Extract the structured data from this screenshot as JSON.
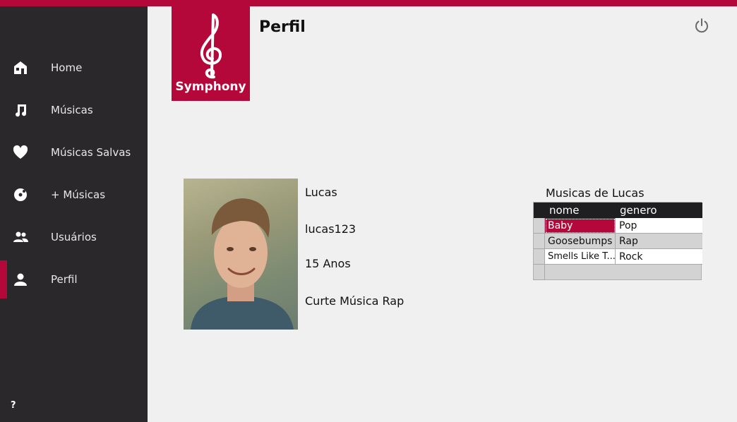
{
  "app": {
    "accent": "#b5083a",
    "sidebar_bg": "#2a282a",
    "logo_text": "Symphony"
  },
  "header": {
    "title": "Perfil",
    "power_icon": "power-icon"
  },
  "sidebar": {
    "items": [
      {
        "label": "Home",
        "icon": "home-icon"
      },
      {
        "label": "Músicas",
        "icon": "music-note-icon"
      },
      {
        "label": "Músicas Salvas",
        "icon": "heart-icon"
      },
      {
        "label": "+ Músicas",
        "icon": "disc-icon"
      },
      {
        "label": "Usuários",
        "icon": "users-icon"
      },
      {
        "label": "Perfil",
        "icon": "person-icon"
      }
    ],
    "active": "Perfil",
    "help": "?"
  },
  "profile": {
    "name": "Lucas",
    "username": "lucas123",
    "age": "15 Anos",
    "bio": "Curte Música Rap"
  },
  "songs_table": {
    "title": "Musicas de Lucas",
    "columns": [
      "nome",
      "genero"
    ],
    "rows": [
      {
        "nome": "Baby",
        "genero": "Pop"
      },
      {
        "nome": "Goosebumps",
        "genero": "Rap"
      },
      {
        "nome": "Smells Like T...",
        "genero": "Rock"
      }
    ]
  }
}
